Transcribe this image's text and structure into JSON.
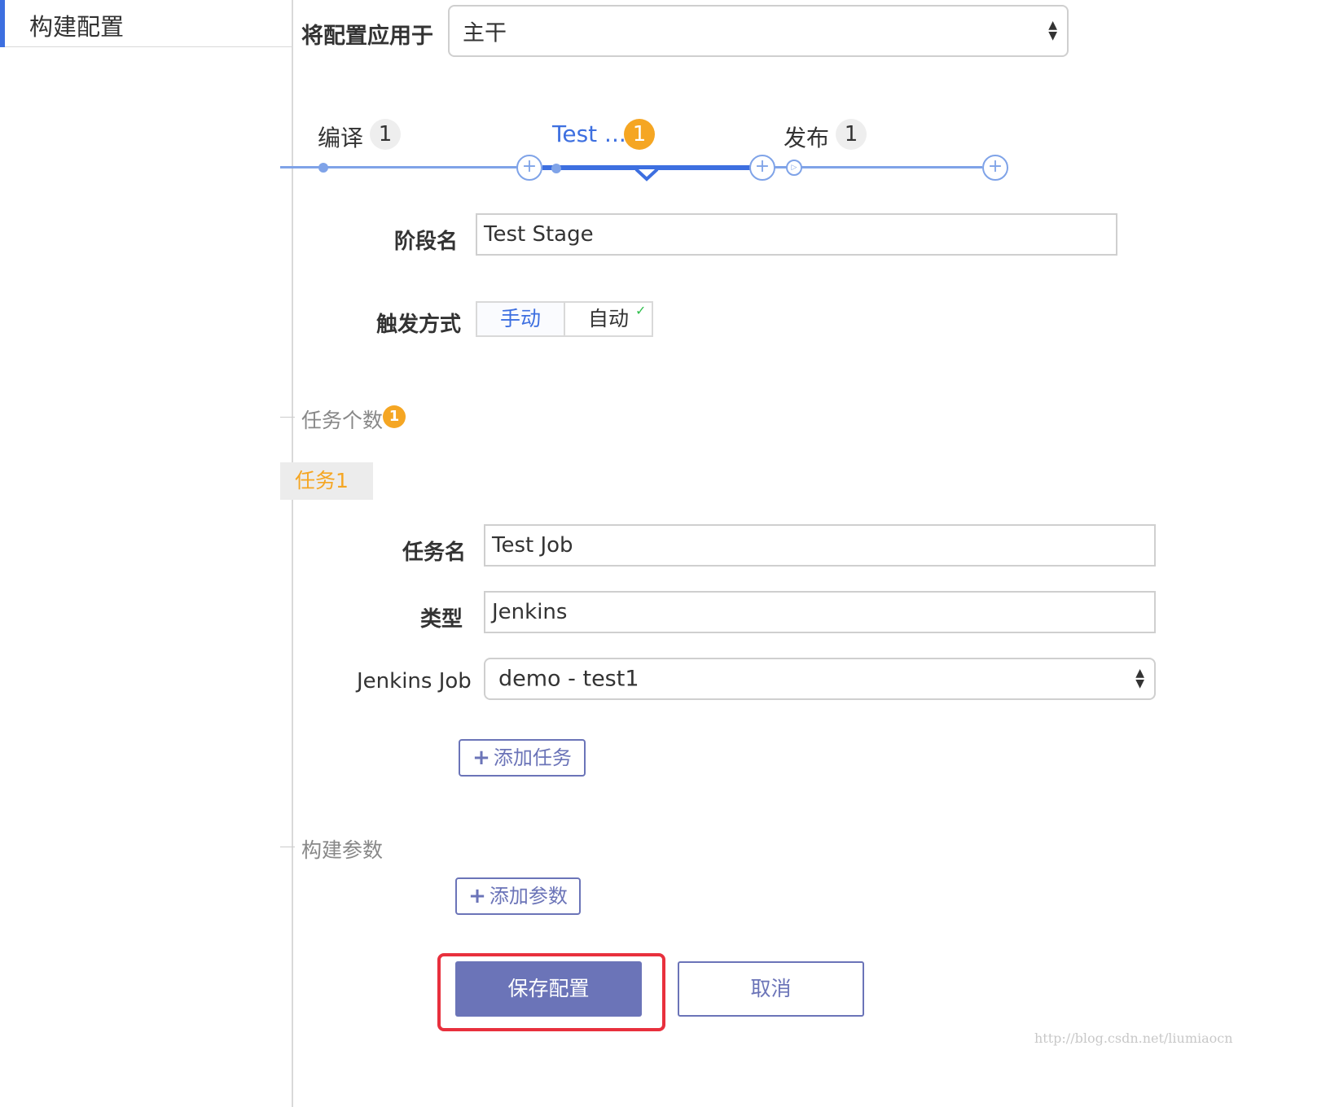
{
  "sidebar": {
    "tab_label": "构建配置"
  },
  "apply_to": {
    "label": "将配置应用于",
    "selected": "主干"
  },
  "stages": [
    {
      "name": "编译",
      "count": "1"
    },
    {
      "name": "Test ...",
      "count": "1"
    },
    {
      "name": "发布",
      "count": "1"
    }
  ],
  "stage_form": {
    "name_label": "阶段名",
    "name_value": "Test Stage",
    "trigger_label": "触发方式",
    "trigger_options": [
      "手动",
      "自动"
    ]
  },
  "tasks_section": {
    "title": "任务个数",
    "count": "1",
    "tab_label": "任务1"
  },
  "task_form": {
    "name_label": "任务名",
    "name_value": "Test Job",
    "type_label": "类型",
    "type_value": "Jenkins",
    "job_label": "Jenkins Job",
    "job_value": "demo - test1",
    "add_task_label": "添加任务"
  },
  "params_section": {
    "title": "构建参数",
    "add_param_label": "添加参数"
  },
  "actions": {
    "save_label": "保存配置",
    "cancel_label": "取消"
  },
  "watermark": "http://blog.csdn.net/liumiaocn",
  "colors": {
    "accent": "#3d6fe0",
    "button": "#6b74b8",
    "badge": "#f5a623",
    "highlight": "#e8303d",
    "check": "#2fbf4c"
  }
}
